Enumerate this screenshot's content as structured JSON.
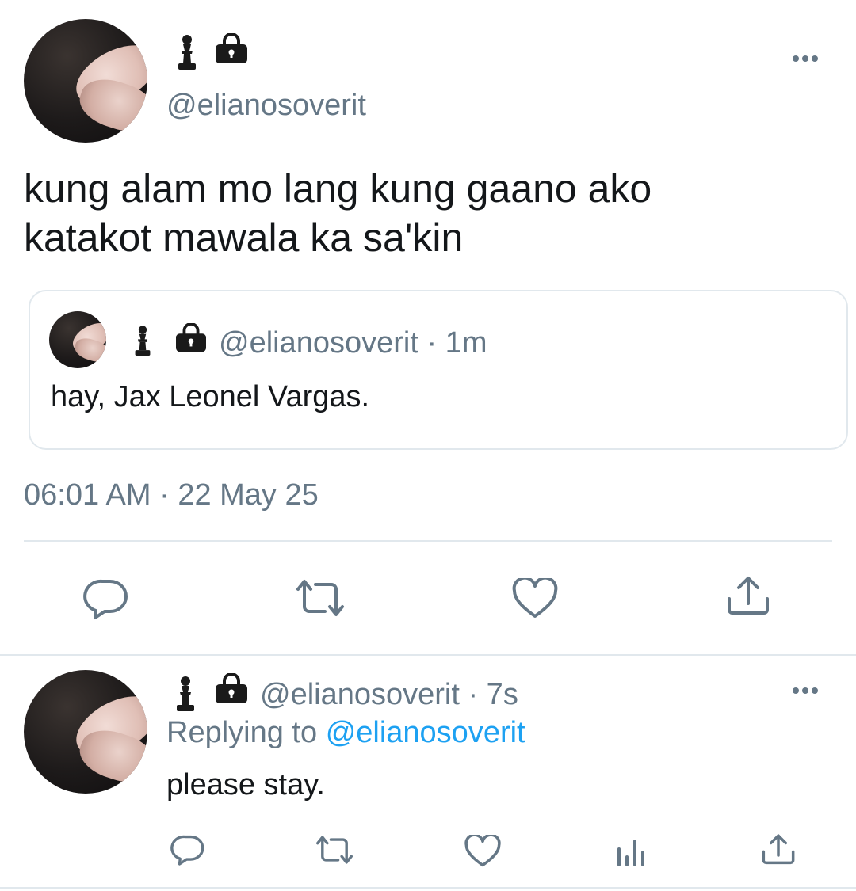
{
  "main_tweet": {
    "handle": "@elianosoverit",
    "text_line1": "kung alam mo lang kung gaano ako",
    "text_line2": "katakot mawala ka sa'kin",
    "timestamp": "06:01 AM · 22 May 25",
    "menu_icon": "more-dots-icon",
    "name_icons": [
      "pawn-icon",
      "lock-icon"
    ]
  },
  "quoted_tweet": {
    "handle_time": "@elianosoverit · 1m",
    "text": "hay, Jax Leonel Vargas."
  },
  "actions_main": [
    "reply-icon",
    "retweet-icon",
    "like-icon",
    "share-icon"
  ],
  "reply_tweet": {
    "handle_time": "@elianosoverit · 7s",
    "replying_prefix": "Replying to",
    "replying_handle": "@elianosoverit",
    "text": "please stay.",
    "actions": [
      "reply-icon",
      "retweet-icon",
      "like-icon",
      "analytics-icon",
      "share-icon"
    ]
  },
  "colors": {
    "text": "#14171a",
    "secondary": "#657786",
    "link": "#1da1f2",
    "border": "#e1e8ed"
  }
}
